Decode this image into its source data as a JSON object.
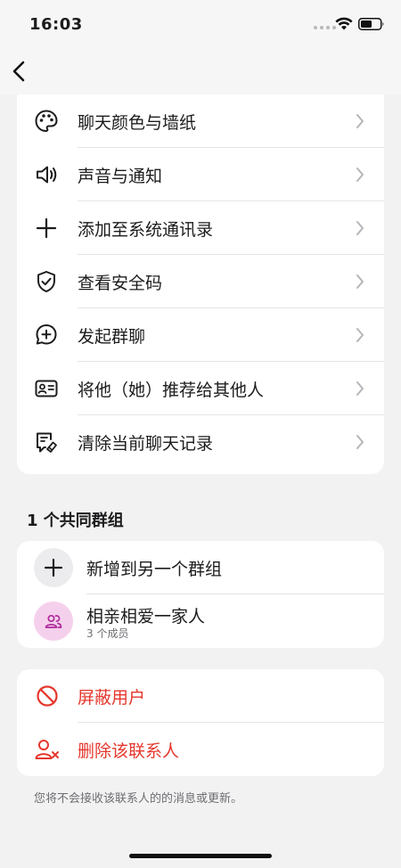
{
  "status_bar": {
    "time": "16:03"
  },
  "settings": {
    "items": [
      {
        "label": "聊天颜色与墙纸",
        "icon": "palette-icon"
      },
      {
        "label": "声音与通知",
        "icon": "speaker-icon"
      },
      {
        "label": "添加至系统通讯录",
        "icon": "plus-icon"
      },
      {
        "label": "查看安全码",
        "icon": "shield-check-icon"
      },
      {
        "label": "发起群聊",
        "icon": "chat-plus-icon"
      },
      {
        "label": "将他（她）推荐给其他人",
        "icon": "contact-card-icon"
      },
      {
        "label": "清除当前聊天记录",
        "icon": "clear-chat-icon"
      }
    ]
  },
  "groups": {
    "title": "1 个共同群组",
    "add_label": "新增到另一个群组",
    "items": [
      {
        "name": "相亲相爱一家人",
        "members": "3 个成员"
      }
    ]
  },
  "danger": {
    "block_label": "屏蔽用户",
    "delete_label": "删除该联系人"
  },
  "footer_note": "您将不会接收该联系人的的消息或更新。",
  "colors": {
    "danger": "#e5372d",
    "group_avatar_bg": "#f5d0ec",
    "group_avatar_fg": "#b02a9a"
  }
}
